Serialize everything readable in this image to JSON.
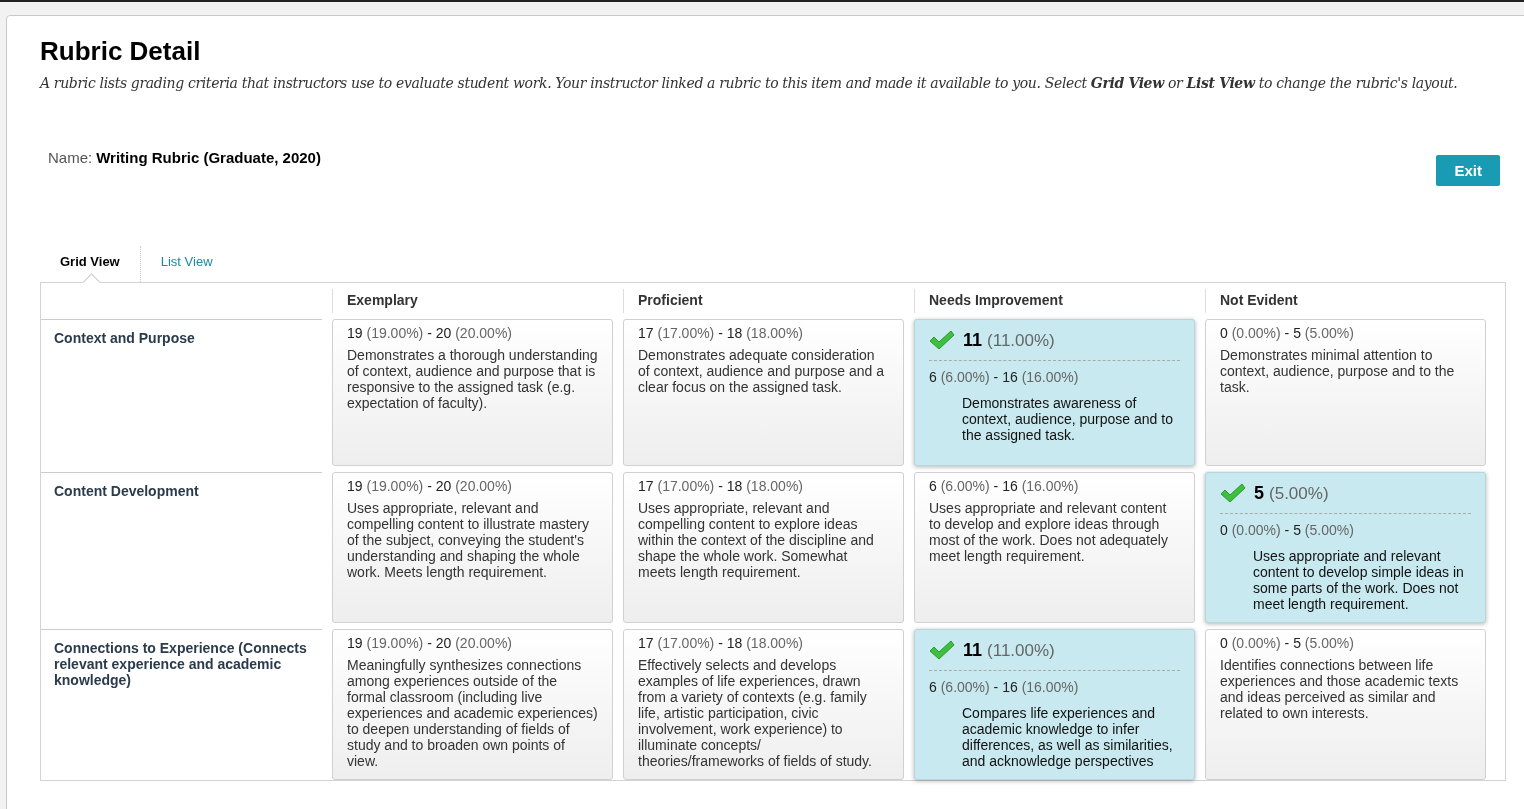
{
  "page": {
    "title": "Rubric Detail",
    "intro": "A rubric lists grading criteria that instructors use to evaluate student work. Your instructor linked a rubric to this item and made it available to you. Select **Grid View** or **List View** to change the rubric's layout."
  },
  "rubric": {
    "label": "Name:",
    "name": "Writing Rubric (Graduate, 2020)"
  },
  "exit_button": "Exit",
  "range_separator": "-",
  "tabs": [
    {
      "label": "Grid View",
      "selected": true
    },
    {
      "label": "List View",
      "selected": false
    }
  ],
  "columns": [
    "Exemplary",
    "Proficient",
    "Needs Improvement",
    "Not Evident"
  ],
  "rows": [
    {
      "criterion": "Context and Purpose",
      "cells": [
        {
          "low": "19",
          "low_pct": "(19.00%)",
          "high": "20",
          "high_pct": "(20.00%)",
          "description": "Demonstrates a thorough understanding of context, audience and purpose that is responsive to the assigned task (e.g. expectation of faculty).",
          "selected": false
        },
        {
          "low": "17",
          "low_pct": "(17.00%)",
          "high": "18",
          "high_pct": "(18.00%)",
          "description": "Demonstrates adequate consideration of context, audience and purpose and a clear focus on the assigned task.",
          "selected": false
        },
        {
          "score": "11",
          "score_pct": "(11.00%)",
          "low": "6",
          "low_pct": "(6.00%)",
          "high": "16",
          "high_pct": "(16.00%)",
          "description": "Demonstrates awareness of context, audience, purpose and to the assigned task.",
          "selected": true
        },
        {
          "low": "0",
          "low_pct": "(0.00%)",
          "high": "5",
          "high_pct": "(5.00%)",
          "description": "Demonstrates minimal attention to context, audience, purpose and to the task.",
          "selected": false
        }
      ]
    },
    {
      "criterion": "Content Development",
      "cells": [
        {
          "low": "19",
          "low_pct": "(19.00%)",
          "high": "20",
          "high_pct": "(20.00%)",
          "description": "Uses appropriate, relevant and compelling content to illustrate mastery of the subject, conveying the student's understanding and shaping the whole work. Meets length requirement.",
          "selected": false
        },
        {
          "low": "17",
          "low_pct": "(17.00%)",
          "high": "18",
          "high_pct": "(18.00%)",
          "description": "Uses appropriate, relevant and compelling content to explore ideas within the context of the discipline and shape the whole work. Somewhat meets length requirement.",
          "selected": false
        },
        {
          "low": "6",
          "low_pct": "(6.00%)",
          "high": "16",
          "high_pct": "(16.00%)",
          "description": "Uses appropriate and relevant content to develop and explore ideas through most of the work. Does not adequately meet length requirement.",
          "selected": false
        },
        {
          "score": "5",
          "score_pct": "(5.00%)",
          "low": "0",
          "low_pct": "(0.00%)",
          "high": "5",
          "high_pct": "(5.00%)",
          "description": "Uses appropriate and relevant content to develop simple ideas in some parts of the work. Does not meet length requirement.",
          "selected": true
        }
      ]
    },
    {
      "criterion": "Connections to Experience (Connects relevant experience and academic knowledge)",
      "cells": [
        {
          "low": "19",
          "low_pct": "(19.00%)",
          "high": "20",
          "high_pct": "(20.00%)",
          "description": "Meaningfully synthesizes connections among experiences outside of the formal classroom (including live experiences and academic experiences) to deepen understanding of fields of study and to broaden own points of view.",
          "selected": false
        },
        {
          "low": "17",
          "low_pct": "(17.00%)",
          "high": "18",
          "high_pct": "(18.00%)",
          "description": "Effectively selects and develops examples of life experiences, drawn from a variety of contexts (e.g. family life, artistic participation, civic involvement, work experience) to illuminate concepts/ theories/frameworks of fields of study.",
          "selected": false
        },
        {
          "score": "11",
          "score_pct": "(11.00%)",
          "low": "6",
          "low_pct": "(6.00%)",
          "high": "16",
          "high_pct": "(16.00%)",
          "description": "Compares life experiences and academic knowledge to infer differences, as well as similarities, and acknowledge perspectives",
          "selected": true
        },
        {
          "low": "0",
          "low_pct": "(0.00%)",
          "high": "5",
          "high_pct": "(5.00%)",
          "description": "Identifies connections between life experiences and those academic texts and ideas perceived as similar and related to own interests.",
          "selected": false
        }
      ]
    }
  ]
}
